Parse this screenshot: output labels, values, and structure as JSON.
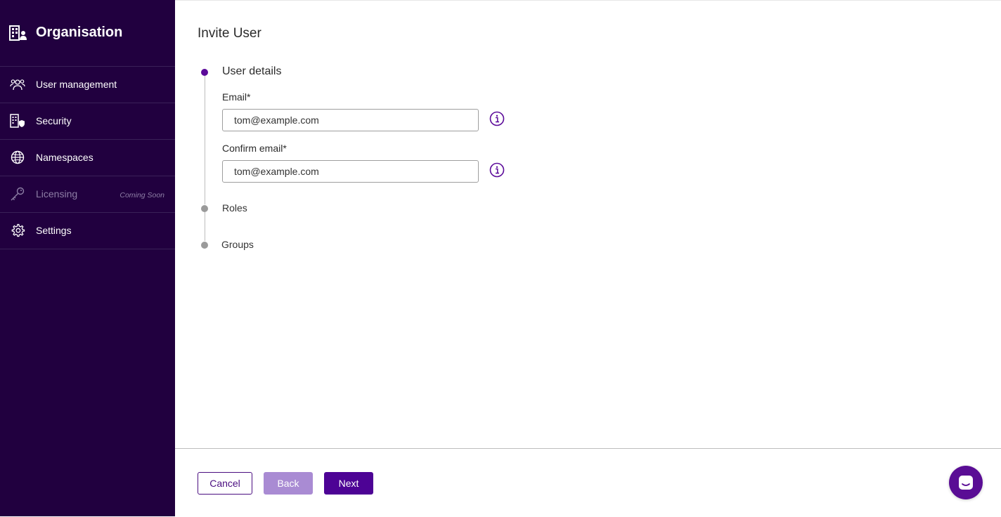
{
  "sidebar": {
    "title": "Organisation",
    "items": [
      {
        "label": "User management",
        "icon": "users-icon"
      },
      {
        "label": "Security",
        "icon": "building-shield-icon"
      },
      {
        "label": "Namespaces",
        "icon": "globe-icon"
      },
      {
        "label": "Licensing",
        "icon": "key-icon",
        "badge": "Coming Soon",
        "disabled": true
      },
      {
        "label": "Settings",
        "icon": "gear-icon"
      }
    ]
  },
  "main": {
    "title": "Invite User",
    "steps": [
      {
        "label": "User details",
        "active": true
      },
      {
        "label": "Roles",
        "active": false
      },
      {
        "label": "Groups",
        "active": false
      }
    ],
    "fields": {
      "email": {
        "label": "Email*",
        "value": "tom@example.com"
      },
      "confirm_email": {
        "label": "Confirm email*",
        "value": "tom@example.com"
      }
    }
  },
  "footer": {
    "cancel_label": "Cancel",
    "back_label": "Back",
    "next_label": "Next"
  },
  "colors": {
    "sidebar_bg": "#21003f",
    "accent": "#5b0a99",
    "button_primary": "#4d0395",
    "button_disabled": "#a98bd3"
  }
}
